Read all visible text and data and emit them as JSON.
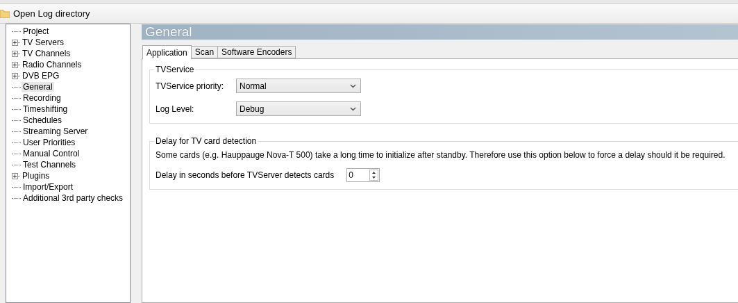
{
  "toolbar": {
    "items": [
      {
        "label": "Open Log directory"
      }
    ]
  },
  "sidebar": {
    "items": [
      {
        "label": "Project",
        "selected": false
      },
      {
        "label": "TV Servers",
        "selected": false,
        "expanded": false
      },
      {
        "label": "TV Channels",
        "selected": false,
        "expanded": false
      },
      {
        "label": "Radio Channels",
        "selected": false,
        "expanded": false
      },
      {
        "label": "DVB EPG",
        "selected": false,
        "expanded": false
      },
      {
        "label": "General",
        "selected": true
      },
      {
        "label": "Recording",
        "selected": false
      },
      {
        "label": "Timeshifting",
        "selected": false
      },
      {
        "label": "Schedules",
        "selected": false
      },
      {
        "label": "Streaming Server",
        "selected": false
      },
      {
        "label": "User Priorities",
        "selected": false
      },
      {
        "label": "Manual Control",
        "selected": false
      },
      {
        "label": "Test Channels",
        "selected": false
      },
      {
        "label": "Plugins",
        "selected": false,
        "expanded": false
      },
      {
        "label": "Import/Export",
        "selected": false
      },
      {
        "label": "Additional 3rd party checks",
        "selected": false
      }
    ]
  },
  "page": {
    "title": "General",
    "tabs": [
      {
        "label": "Application",
        "selected": true
      },
      {
        "label": "Scan",
        "selected": false
      },
      {
        "label": "Software Encoders",
        "selected": false
      }
    ],
    "groups": [
      {
        "title": "TVService",
        "fields": [
          {
            "kind": "dropdown",
            "label": "TVService priority:",
            "value": "Normal"
          },
          {
            "kind": "dropdown",
            "label": "Log Level:",
            "value": "Debug"
          }
        ]
      },
      {
        "title": "Delay for TV card detection",
        "note": "Some cards (e.g. Hauppauge Nova-T 500) take a long time to initialize after standby. Therefore use this option below to force a delay should it be required.",
        "fields": [
          {
            "kind": "spinner",
            "label": "Delay in seconds before TVServer detects cards",
            "value": "0"
          }
        ]
      }
    ]
  }
}
